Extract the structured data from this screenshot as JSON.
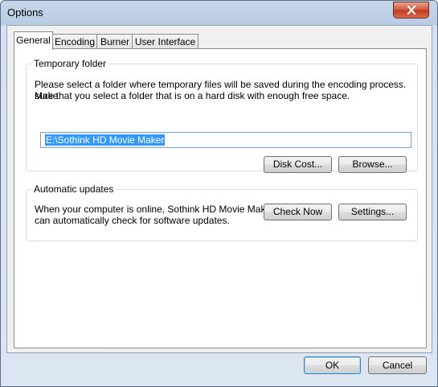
{
  "window": {
    "title": "Options"
  },
  "tabs": [
    {
      "label": "General",
      "active": true
    },
    {
      "label": "Encoding",
      "active": false
    },
    {
      "label": "Burner",
      "active": false
    },
    {
      "label": "User Interface",
      "active": false
    }
  ],
  "temp_folder": {
    "title": "Temporary folder",
    "description_line1": "Please select a folder where temporary files will be saved during the encoding process. Make",
    "description_line2": "sure that you select a folder that is on a hard disk with enough free space.",
    "path_value": "E:\\Sothink HD Movie Maker",
    "disk_cost_label": "Disk Cost...",
    "browse_label": "Browse..."
  },
  "auto_updates": {
    "title": "Automatic updates",
    "description_line1": "When your computer is online, Sothink HD Movie Maker",
    "description_line2": "can automatically check for software updates.",
    "check_now_label": "Check Now",
    "settings_label": "Settings..."
  },
  "footer": {
    "ok_label": "OK",
    "cancel_label": "Cancel"
  },
  "colors": {
    "selection": "#3399ff",
    "close_button": "#c1391f",
    "frame": "#b9cce4"
  },
  "icons": {
    "close": "close-icon"
  }
}
